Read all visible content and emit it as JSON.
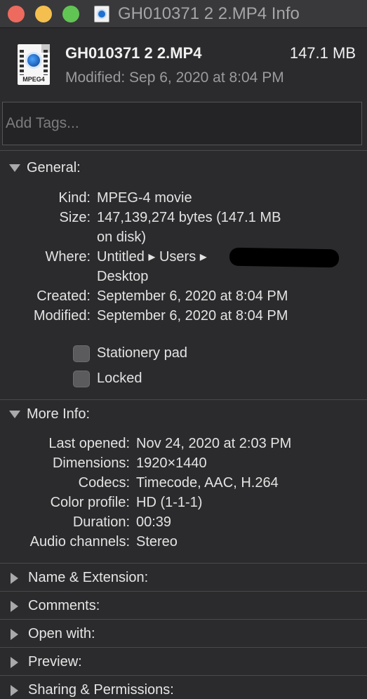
{
  "window": {
    "title": "GH010371 2 2.MP4 Info",
    "traffic_lights": [
      "close",
      "minimize",
      "zoom"
    ]
  },
  "header": {
    "filename": "GH010371 2 2.MP4",
    "size": "147.1 MB",
    "modified": "Modified: Sep 6, 2020 at 8:04 PM",
    "icon": "mpeg4-file-icon",
    "icon_ext": "MPEG4"
  },
  "tags": {
    "placeholder": "Add Tags..."
  },
  "general": {
    "title": "General:",
    "expanded": true,
    "kind_label": "Kind:",
    "kind_value": "MPEG-4 movie",
    "size_label": "Size:",
    "size_value_1": "147,139,274 bytes (147.1 MB",
    "size_value_2": "on disk)",
    "where_label": "Where:",
    "where_value_1": "Untitled ▸ Users ▸",
    "where_value_2": "Desktop",
    "created_label": "Created:",
    "created_value": "September 6, 2020 at 8:04 PM",
    "modified_label": "Modified:",
    "modified_value": "September 6, 2020 at 8:04 PM",
    "stationery_label": "Stationery pad",
    "stationery_checked": false,
    "locked_label": "Locked",
    "locked_checked": false
  },
  "more_info": {
    "title": "More Info:",
    "expanded": true,
    "rows": [
      {
        "label": "Last opened:",
        "value": "Nov 24, 2020 at 2:03 PM"
      },
      {
        "label": "Dimensions:",
        "value": "1920×1440"
      },
      {
        "label": "Codecs:",
        "value": "Timecode, AAC, H.264"
      },
      {
        "label": "Color profile:",
        "value": "HD (1-1-1)"
      },
      {
        "label": "Duration:",
        "value": "00:39"
      },
      {
        "label": "Audio channels:",
        "value": "Stereo"
      }
    ]
  },
  "collapsed_sections": [
    "Name & Extension:",
    "Comments:",
    "Open with:",
    "Preview:",
    "Sharing & Permissions:"
  ],
  "colors": {
    "background": "#2b2b2d",
    "titlebar": "#39393b",
    "close": "#ed6a5e",
    "minimize": "#f4bf4f",
    "zoom": "#61c554"
  }
}
